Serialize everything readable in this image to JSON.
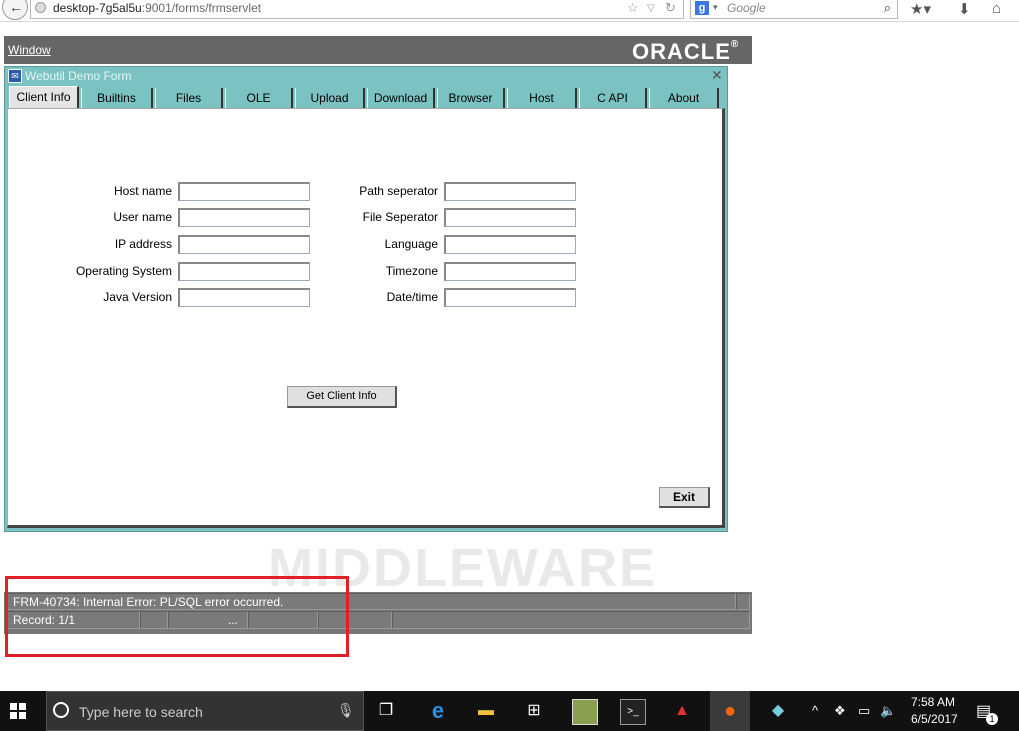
{
  "browser": {
    "url_host": "desktop-7g5al5u",
    "url_rest": ":9001/forms/frmservlet",
    "search_engine": "Google",
    "search_placeholder": "Google"
  },
  "forms": {
    "window_menu": "Window",
    "logo_text": "ORACLE",
    "logo_mark": "®",
    "form_title": "Webutil Demo Form",
    "tabs": [
      {
        "label": "Client Info"
      },
      {
        "label": "Builtins"
      },
      {
        "label": "Files"
      },
      {
        "label": "OLE"
      },
      {
        "label": "Upload"
      },
      {
        "label": "Download"
      },
      {
        "label": "Browser"
      },
      {
        "label": "Host"
      },
      {
        "label": "C API"
      },
      {
        "label": "About"
      }
    ],
    "left_fields": [
      {
        "label": "Host name",
        "value": ""
      },
      {
        "label": "User name",
        "value": ""
      },
      {
        "label": "IP address",
        "value": ""
      },
      {
        "label": "Operating System",
        "value": ""
      },
      {
        "label": "Java Version",
        "value": ""
      }
    ],
    "right_fields": [
      {
        "label": "Path seperator",
        "value": ""
      },
      {
        "label": "File Seperator",
        "value": ""
      },
      {
        "label": "Language",
        "value": ""
      },
      {
        "label": "Timezone",
        "value": ""
      },
      {
        "label": "Date/time",
        "value": ""
      }
    ],
    "get_client_info_label": "Get Client Info",
    "exit_label": "Exit"
  },
  "watermark": "MIDDLEWARE",
  "status": {
    "message": "FRM-40734: Internal Error: PL/SQL error occurred.",
    "record": "Record: 1/1",
    "ellipsis": "..."
  },
  "highlight_color": "#e0202a",
  "taskbar": {
    "search_placeholder": "Type here to search",
    "time": "7:58 AM",
    "date": "6/5/2017",
    "notification_count": "1"
  }
}
